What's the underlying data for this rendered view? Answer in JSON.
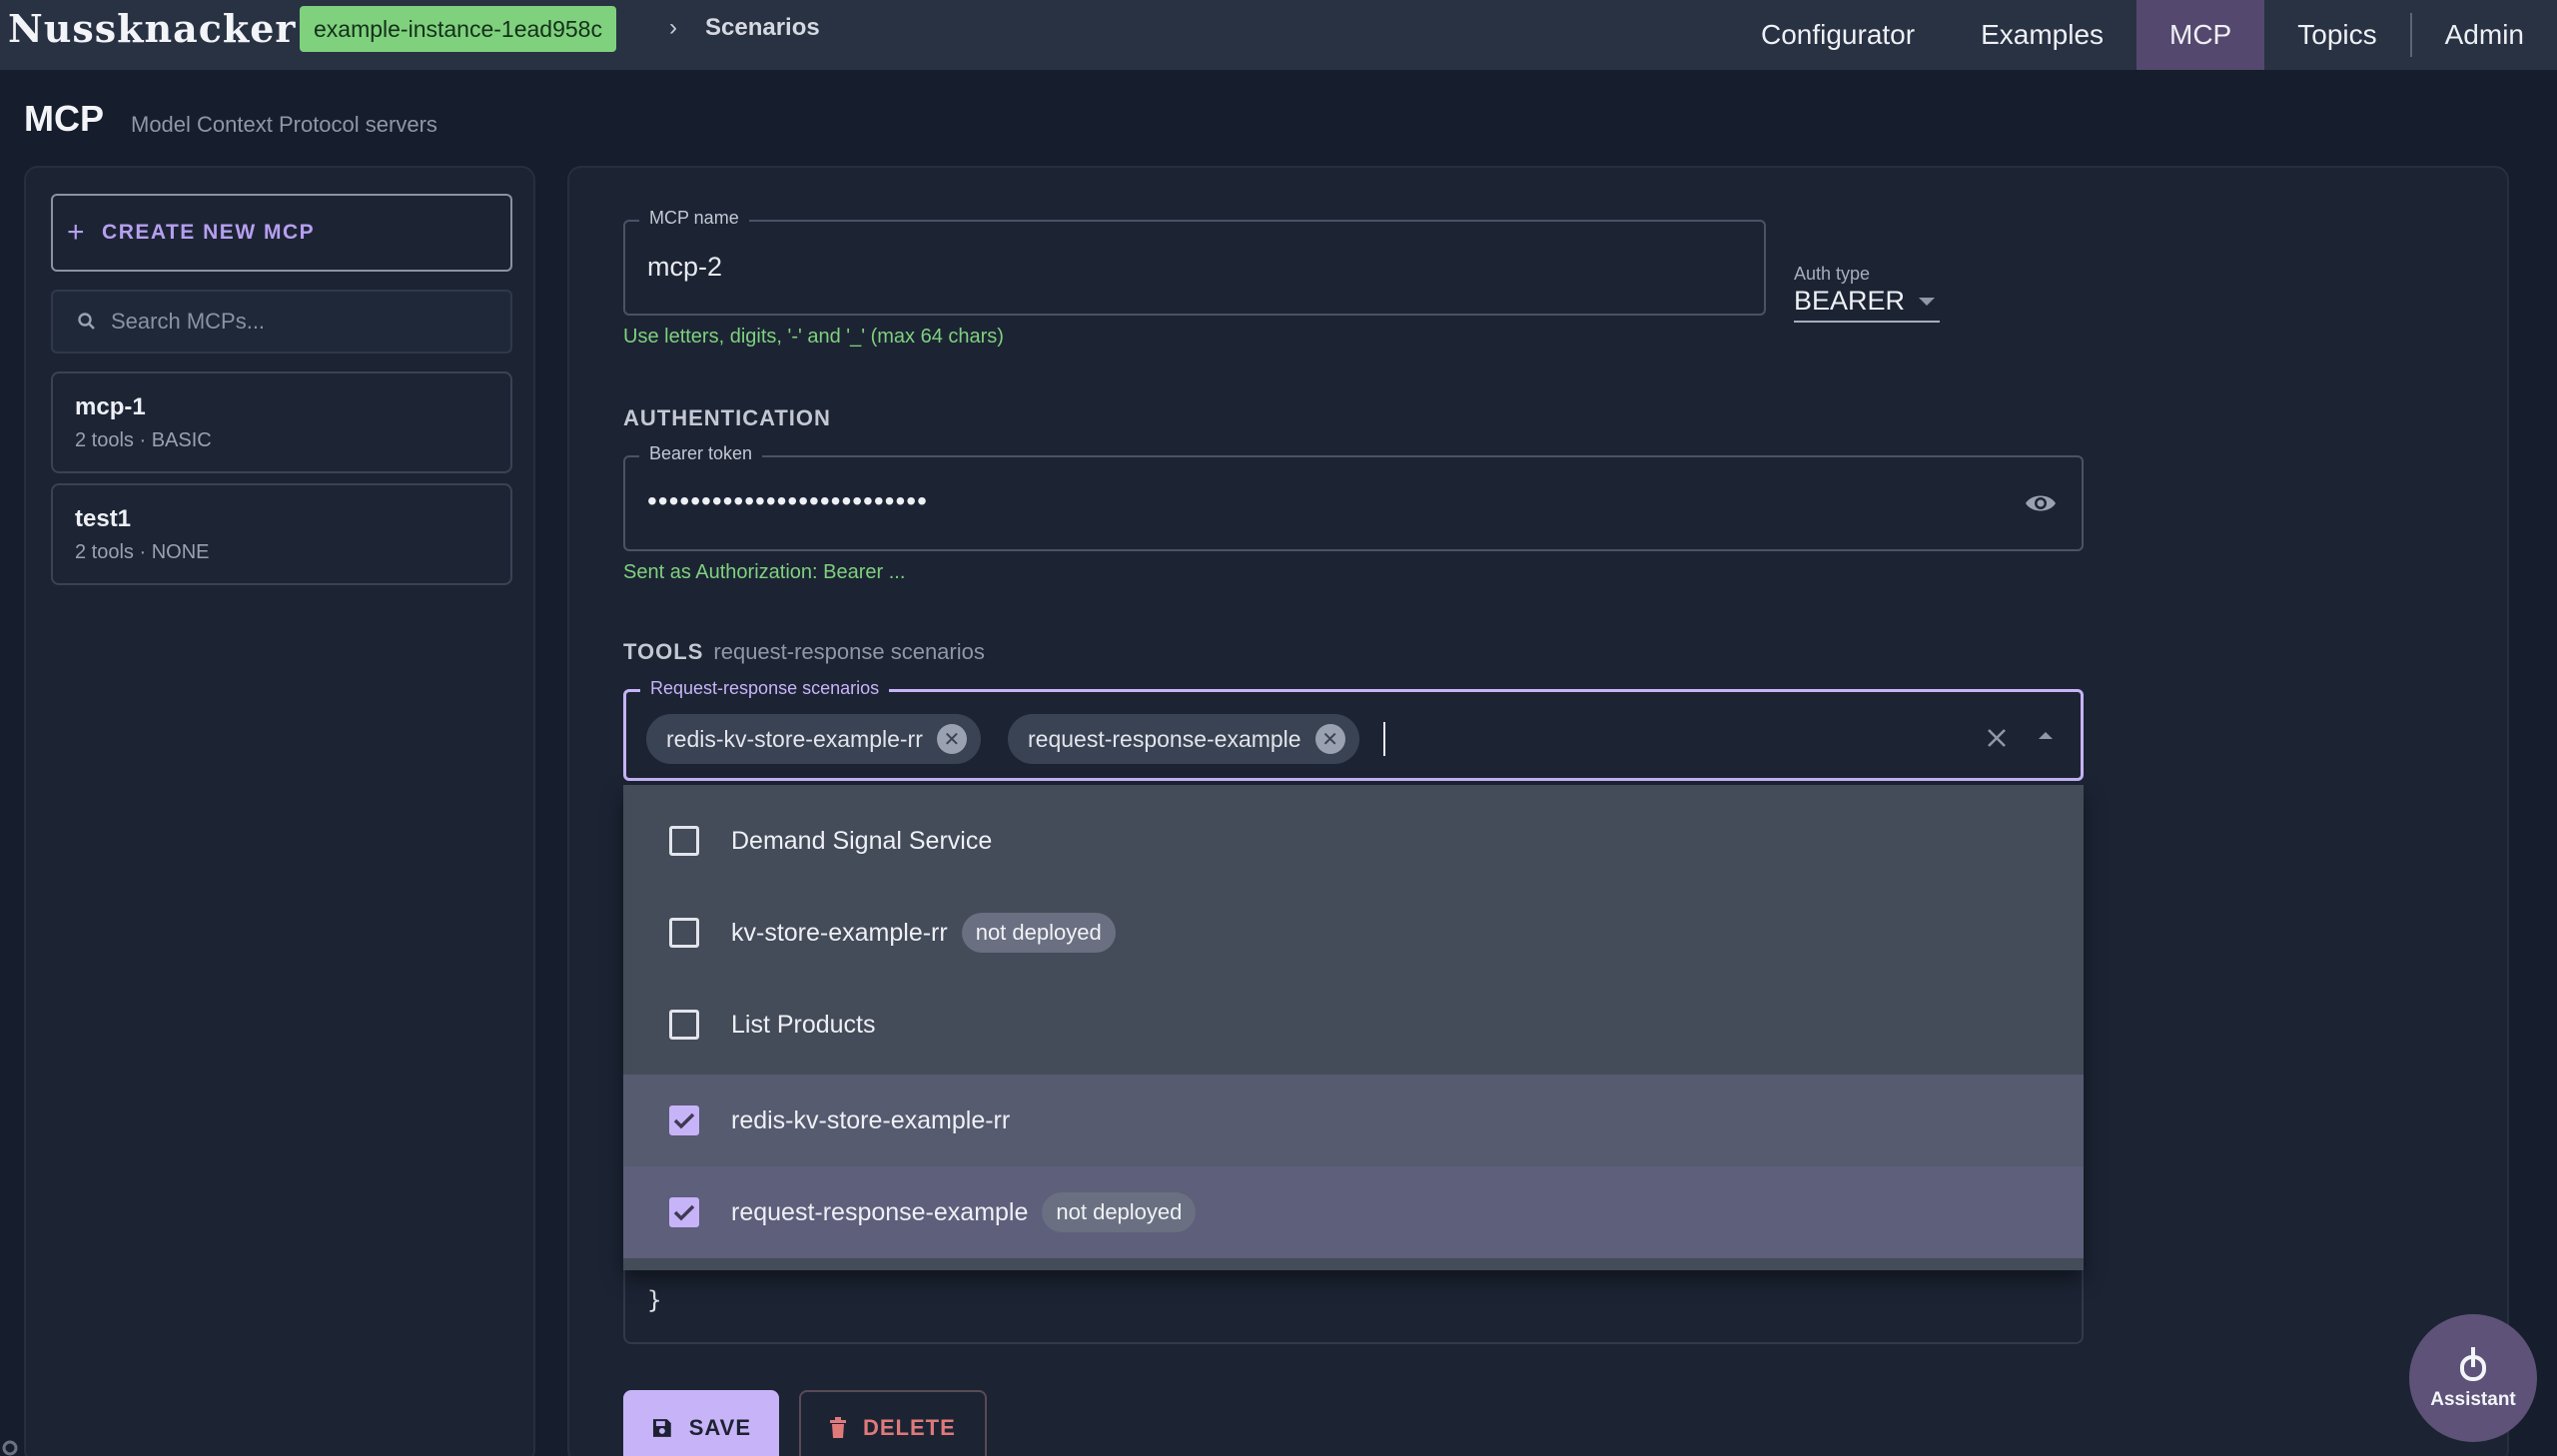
{
  "header": {
    "logo": "Nussknacker",
    "instance": "example-instance-1ead958c",
    "breadcrumb_sep": "›",
    "breadcrumb": "Scenarios",
    "nav": [
      "Configurator",
      "Examples",
      "MCP",
      "Topics",
      "Admin"
    ],
    "active_nav": "MCP"
  },
  "page": {
    "title": "MCP",
    "subtitle": "Model Context Protocol servers"
  },
  "sidebar": {
    "create_label": "CREATE NEW MCP",
    "search_placeholder": "Search MCPs...",
    "items": [
      {
        "name": "mcp-1",
        "meta": "2 tools · BASIC"
      },
      {
        "name": "test1",
        "meta": "2 tools · NONE"
      }
    ]
  },
  "form": {
    "mcp_name_label": "MCP name",
    "mcp_name_value": "mcp-2",
    "mcp_name_helper": "Use letters, digits, '-' and '_' (max 64 chars)",
    "auth_type_label": "Auth type",
    "auth_type_value": "BEARER",
    "authentication_heading": "AUTHENTICATION",
    "bearer_label": "Bearer token",
    "bearer_masked": "••••••••••••••••••••••••••",
    "bearer_helper": "Sent as Authorization: Bearer ...",
    "tools_heading": "TOOLS",
    "tools_sub": "request-response scenarios",
    "scenarios_label": "Request-response scenarios",
    "chips": [
      "redis-kv-store-example-rr",
      "request-response-example"
    ],
    "code_brace": "}"
  },
  "dropdown": {
    "options": [
      {
        "label": "Demand Signal Service",
        "checked": false,
        "tag": ""
      },
      {
        "label": "kv-store-example-rr",
        "checked": false,
        "tag": "not deployed"
      },
      {
        "label": "List Products",
        "checked": false,
        "tag": ""
      },
      {
        "label": "redis-kv-store-example-rr",
        "checked": true,
        "tag": ""
      },
      {
        "label": "request-response-example",
        "checked": true,
        "tag": "not deployed"
      }
    ]
  },
  "actions": {
    "save": "SAVE",
    "delete": "DELETE",
    "assistant": "Assistant"
  },
  "colors": {
    "accent": "#c7b3f7",
    "instance_badge": "#7fd17d",
    "danger": "#e07a7a"
  }
}
